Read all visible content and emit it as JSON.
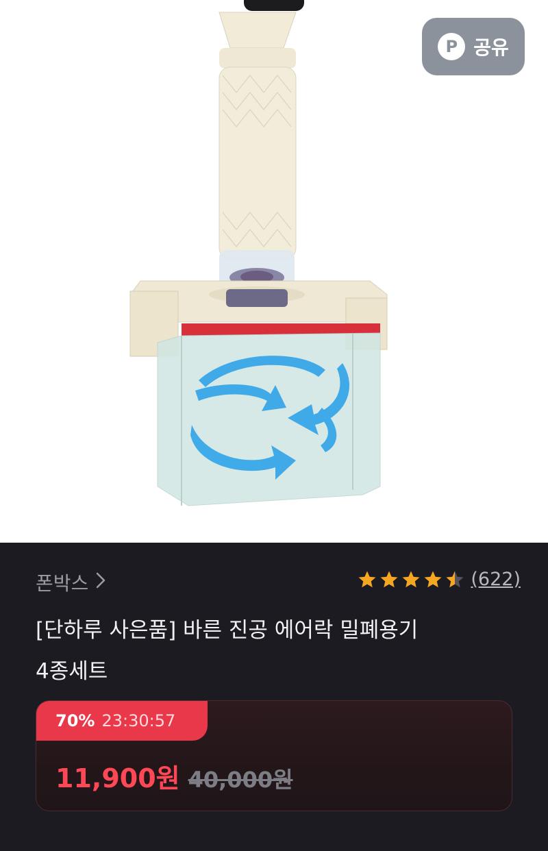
{
  "share": {
    "icon_letter": "P",
    "label": "공유"
  },
  "product": {
    "brand": "폰박스",
    "rating": 4.5,
    "review_count": "(622)",
    "title_line1": "[단하루 사은품] 바른 진공 에어락 밀폐용기",
    "title_line2": "4종세트"
  },
  "deal": {
    "discount": "70%",
    "timer": "23:30:57",
    "sale_price": "11,900원",
    "original_price": "40,000원"
  },
  "colors": {
    "accent": "#e8384a",
    "sale_price": "#ff4856",
    "star": "#f5a623",
    "background_dark": "#1c1b21"
  },
  "icons": {
    "share": "share-p-icon",
    "chevron": "chevron-right-icon",
    "star": "star-icon"
  }
}
